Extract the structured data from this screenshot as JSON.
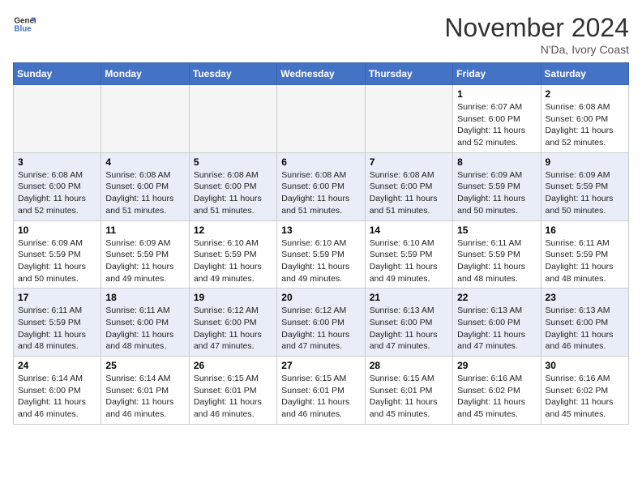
{
  "header": {
    "logo_line1": "General",
    "logo_line2": "Blue",
    "month_title": "November 2024",
    "location": "N'Da, Ivory Coast"
  },
  "days_of_week": [
    "Sunday",
    "Monday",
    "Tuesday",
    "Wednesday",
    "Thursday",
    "Friday",
    "Saturday"
  ],
  "weeks": [
    [
      {
        "day": "",
        "info": ""
      },
      {
        "day": "",
        "info": ""
      },
      {
        "day": "",
        "info": ""
      },
      {
        "day": "",
        "info": ""
      },
      {
        "day": "",
        "info": ""
      },
      {
        "day": "1",
        "info": "Sunrise: 6:07 AM\nSunset: 6:00 PM\nDaylight: 11 hours and 52 minutes."
      },
      {
        "day": "2",
        "info": "Sunrise: 6:08 AM\nSunset: 6:00 PM\nDaylight: 11 hours and 52 minutes."
      }
    ],
    [
      {
        "day": "3",
        "info": "Sunrise: 6:08 AM\nSunset: 6:00 PM\nDaylight: 11 hours and 52 minutes."
      },
      {
        "day": "4",
        "info": "Sunrise: 6:08 AM\nSunset: 6:00 PM\nDaylight: 11 hours and 51 minutes."
      },
      {
        "day": "5",
        "info": "Sunrise: 6:08 AM\nSunset: 6:00 PM\nDaylight: 11 hours and 51 minutes."
      },
      {
        "day": "6",
        "info": "Sunrise: 6:08 AM\nSunset: 6:00 PM\nDaylight: 11 hours and 51 minutes."
      },
      {
        "day": "7",
        "info": "Sunrise: 6:08 AM\nSunset: 6:00 PM\nDaylight: 11 hours and 51 minutes."
      },
      {
        "day": "8",
        "info": "Sunrise: 6:09 AM\nSunset: 5:59 PM\nDaylight: 11 hours and 50 minutes."
      },
      {
        "day": "9",
        "info": "Sunrise: 6:09 AM\nSunset: 5:59 PM\nDaylight: 11 hours and 50 minutes."
      }
    ],
    [
      {
        "day": "10",
        "info": "Sunrise: 6:09 AM\nSunset: 5:59 PM\nDaylight: 11 hours and 50 minutes."
      },
      {
        "day": "11",
        "info": "Sunrise: 6:09 AM\nSunset: 5:59 PM\nDaylight: 11 hours and 49 minutes."
      },
      {
        "day": "12",
        "info": "Sunrise: 6:10 AM\nSunset: 5:59 PM\nDaylight: 11 hours and 49 minutes."
      },
      {
        "day": "13",
        "info": "Sunrise: 6:10 AM\nSunset: 5:59 PM\nDaylight: 11 hours and 49 minutes."
      },
      {
        "day": "14",
        "info": "Sunrise: 6:10 AM\nSunset: 5:59 PM\nDaylight: 11 hours and 49 minutes."
      },
      {
        "day": "15",
        "info": "Sunrise: 6:11 AM\nSunset: 5:59 PM\nDaylight: 11 hours and 48 minutes."
      },
      {
        "day": "16",
        "info": "Sunrise: 6:11 AM\nSunset: 5:59 PM\nDaylight: 11 hours and 48 minutes."
      }
    ],
    [
      {
        "day": "17",
        "info": "Sunrise: 6:11 AM\nSunset: 5:59 PM\nDaylight: 11 hours and 48 minutes."
      },
      {
        "day": "18",
        "info": "Sunrise: 6:11 AM\nSunset: 6:00 PM\nDaylight: 11 hours and 48 minutes."
      },
      {
        "day": "19",
        "info": "Sunrise: 6:12 AM\nSunset: 6:00 PM\nDaylight: 11 hours and 47 minutes."
      },
      {
        "day": "20",
        "info": "Sunrise: 6:12 AM\nSunset: 6:00 PM\nDaylight: 11 hours and 47 minutes."
      },
      {
        "day": "21",
        "info": "Sunrise: 6:13 AM\nSunset: 6:00 PM\nDaylight: 11 hours and 47 minutes."
      },
      {
        "day": "22",
        "info": "Sunrise: 6:13 AM\nSunset: 6:00 PM\nDaylight: 11 hours and 47 minutes."
      },
      {
        "day": "23",
        "info": "Sunrise: 6:13 AM\nSunset: 6:00 PM\nDaylight: 11 hours and 46 minutes."
      }
    ],
    [
      {
        "day": "24",
        "info": "Sunrise: 6:14 AM\nSunset: 6:00 PM\nDaylight: 11 hours and 46 minutes."
      },
      {
        "day": "25",
        "info": "Sunrise: 6:14 AM\nSunset: 6:01 PM\nDaylight: 11 hours and 46 minutes."
      },
      {
        "day": "26",
        "info": "Sunrise: 6:15 AM\nSunset: 6:01 PM\nDaylight: 11 hours and 46 minutes."
      },
      {
        "day": "27",
        "info": "Sunrise: 6:15 AM\nSunset: 6:01 PM\nDaylight: 11 hours and 46 minutes."
      },
      {
        "day": "28",
        "info": "Sunrise: 6:15 AM\nSunset: 6:01 PM\nDaylight: 11 hours and 45 minutes."
      },
      {
        "day": "29",
        "info": "Sunrise: 6:16 AM\nSunset: 6:02 PM\nDaylight: 11 hours and 45 minutes."
      },
      {
        "day": "30",
        "info": "Sunrise: 6:16 AM\nSunset: 6:02 PM\nDaylight: 11 hours and 45 minutes."
      }
    ]
  ]
}
